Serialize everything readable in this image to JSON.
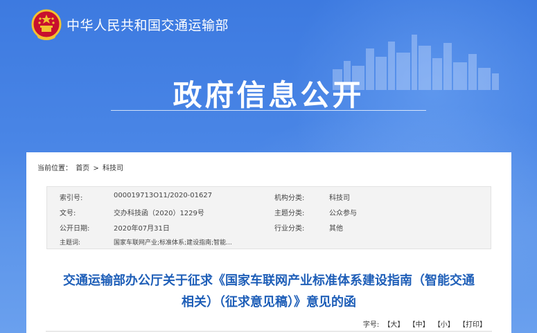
{
  "header": {
    "site_name": "中华人民共和国交通运输部",
    "hero_title": "政府信息公开"
  },
  "breadcrumb": {
    "prefix": "当前位置：",
    "home": "首页",
    "separator": ">",
    "current": "科技司"
  },
  "info": {
    "index_label": "索引号:",
    "index_value": "000019713O11/2020-01627",
    "org_label": "机构分类:",
    "org_value": "科技司",
    "docno_label": "文号:",
    "docno_value": "交办科技函（2020）1229号",
    "topic_label": "主题分类:",
    "topic_value": "公众参与",
    "date_label": "公开日期:",
    "date_value": "2020年07月31日",
    "industry_label": "行业分类:",
    "industry_value": "其他",
    "keywords_label": "主题词:",
    "keywords_value": "国家车联网产业;标准体系;建设指南;智能..."
  },
  "document": {
    "title_line1": "交通运输部办公厅关于征求《国家车联网产业标准体系建设指南（智能交通",
    "title_line2": "相关）（征求意见稿）》意见的函"
  },
  "font_size_control": {
    "label": "字号:",
    "large": "【大】",
    "medium": "【中】",
    "small": "【小】",
    "print": "【打印】"
  },
  "colors": {
    "banner_blue": "#3d7ae0",
    "title_blue": "#1f5fb8"
  }
}
